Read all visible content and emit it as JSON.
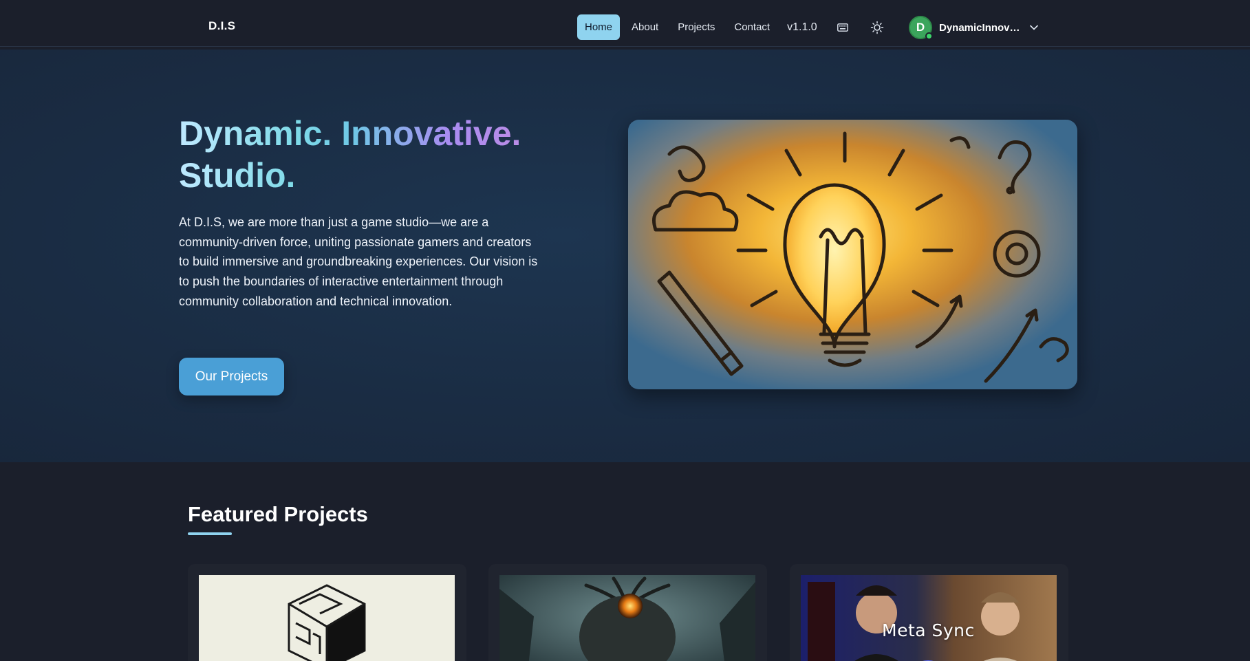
{
  "nav": {
    "brand": "D.I.S",
    "links": [
      {
        "label": "Home",
        "active": true
      },
      {
        "label": "About",
        "active": false
      },
      {
        "label": "Projects",
        "active": false
      },
      {
        "label": "Contact",
        "active": false
      }
    ],
    "version": "v1.1.0",
    "icons": [
      "keyboard-icon",
      "sun-icon",
      "chevron-down-icon"
    ],
    "user": {
      "initial": "D",
      "name": "DynamicInnovati...",
      "status": "online"
    }
  },
  "hero": {
    "title_line1": "Dynamic. Innovative.",
    "title_line2": "Studio.",
    "description": "At D.I.S, we are more than just a game studio—we are a community-driven force, uniting passionate gamers and creators to build immersive and groundbreaking experiences. Our vision is to push the boundaries of interactive entertainment through community collaboration and technical innovation.",
    "button_label": "Our Projects"
  },
  "featured": {
    "title": "Featured Projects",
    "cards": [
      {
        "label": ""
      },
      {
        "label": ""
      },
      {
        "label": "Meta Sync"
      }
    ]
  },
  "colors": {
    "accent": "#8fd3ef",
    "button": "#4a9fd6",
    "background": "#1b1f2b",
    "online": "#3dd66b"
  }
}
